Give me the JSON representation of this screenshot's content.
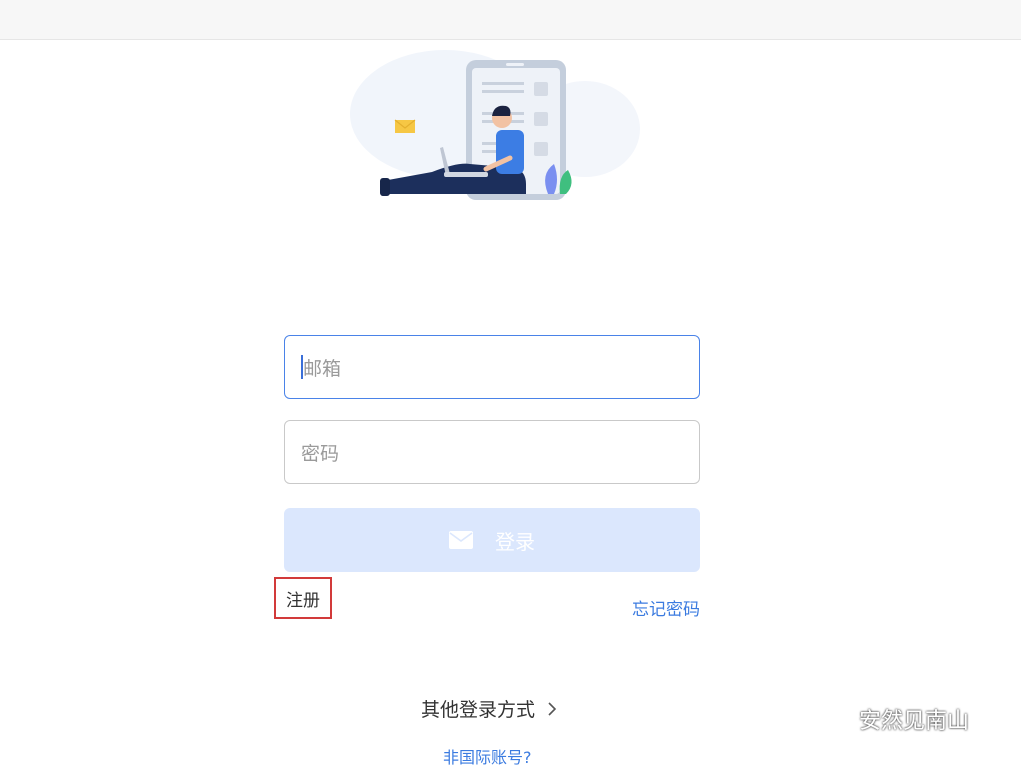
{
  "login": {
    "email_placeholder": "邮箱",
    "password_placeholder": "密码",
    "login_label": "登录",
    "register_label": "注册",
    "forgot_password_label": "忘记密码",
    "other_login_label": "其他登录方式",
    "non_international_label": "非国际账号?"
  },
  "watermark": {
    "text": "安然见南山",
    "icon": "wechat-icon"
  },
  "colors": {
    "accent": "#3b7be0",
    "input_focus_border": "#4a83e8",
    "button_disabled_bg": "#dbe7fd",
    "highlight_box": "#d23a3a"
  }
}
